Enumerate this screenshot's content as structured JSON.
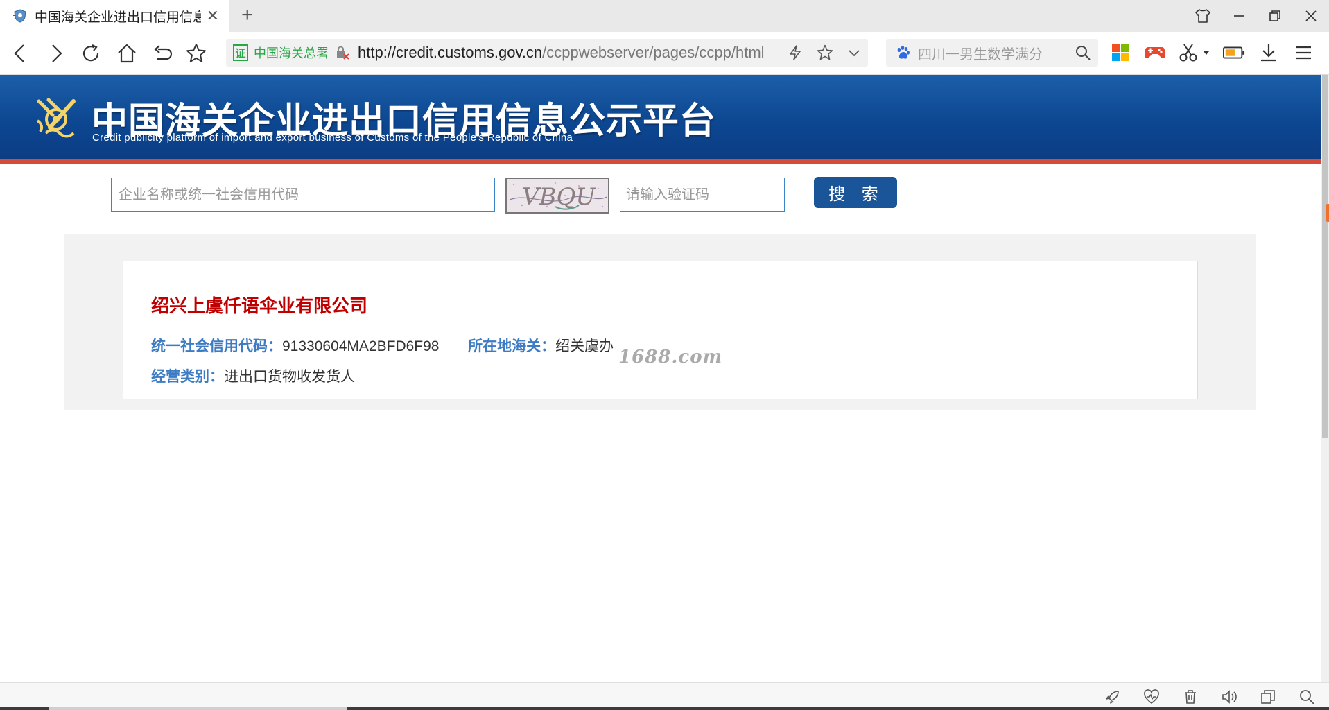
{
  "browser": {
    "tab": {
      "title": "中国海关企业进出口信用信息公示平台",
      "favicon": "shield-favicon"
    },
    "address_bar": {
      "cert_label": "证",
      "cert_name": "中国海关总署",
      "url_host": "http://credit.customs.gov.cn",
      "url_path": "/ccppwebserver/pages/ccpp/html"
    },
    "search_box": {
      "text": "四川一男生数学满分"
    }
  },
  "site": {
    "title": "中国海关企业进出口信用信息公示平台",
    "subtitle": "Credit publicity platform of import and export business of Customs of the People's Republic of China",
    "colors": {
      "banner": "#0d4792",
      "accent_red": "#d64a3a",
      "button": "#1a5499",
      "company_name": "#c00000",
      "label": "#3d7cc4"
    }
  },
  "search_form": {
    "company_placeholder": "企业名称或统一社会信用代码",
    "captcha_text": "VBQU",
    "captcha_placeholder": "请输入验证码",
    "search_button": "搜 索"
  },
  "result": {
    "company_name": "绍兴上虞仟语伞业有限公司",
    "credit_code_label": "统一社会信用代码：",
    "credit_code_value": "91330604MA2BFD6F98",
    "customs_label": "所在地海关：",
    "customs_value": "绍关虞办",
    "business_type_label": "经营类别：",
    "business_type_value": "进出口货物收发货人"
  },
  "watermark": "1688.com"
}
